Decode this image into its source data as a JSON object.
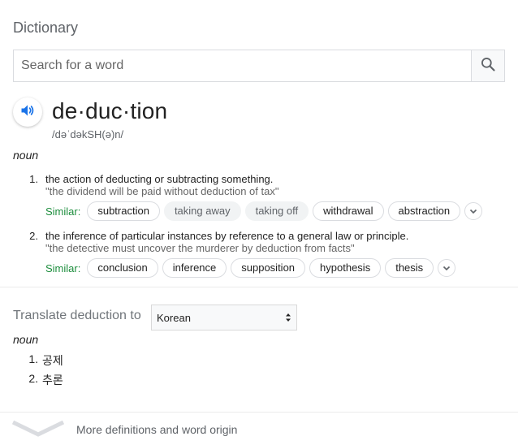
{
  "widget": {
    "title": "Dictionary"
  },
  "search": {
    "placeholder": "Search for a word"
  },
  "entry": {
    "word": "de·duc·tion",
    "phonetic": "/dəˈdəkSH(ə)n/",
    "part_of_speech": "noun",
    "senses": [
      {
        "number": "1.",
        "definition": "the action of deducting or subtracting something.",
        "example": "\"the dividend will be paid without deduction of tax\"",
        "similar_label": "Similar:",
        "similar": [
          "subtraction",
          "taking away",
          "taking off",
          "withdrawal",
          "abstraction"
        ]
      },
      {
        "number": "2.",
        "definition": "the inference of particular instances by reference to a general law or principle.",
        "example": "\"the detective must uncover the murderer by deduction from facts\"",
        "similar_label": "Similar:",
        "similar": [
          "conclusion",
          "inference",
          "supposition",
          "hypothesis",
          "thesis"
        ]
      }
    ]
  },
  "translate": {
    "label": "Translate deduction to",
    "language": "Korean",
    "part_of_speech": "noun",
    "items": [
      {
        "number": "1.",
        "text": "공제"
      },
      {
        "number": "2.",
        "text": "추론"
      }
    ]
  },
  "footer": {
    "more_label": "More definitions and word origin"
  },
  "icons": {
    "search": "search-icon",
    "speaker": "speaker-icon",
    "expand": "chevron-down-icon",
    "select": "select-arrows-icon",
    "more": "chevron-down-icon"
  },
  "colors": {
    "accent_blue": "#1a73e8",
    "similar_green": "#1e8e3e",
    "muted_text": "#5f6368"
  }
}
